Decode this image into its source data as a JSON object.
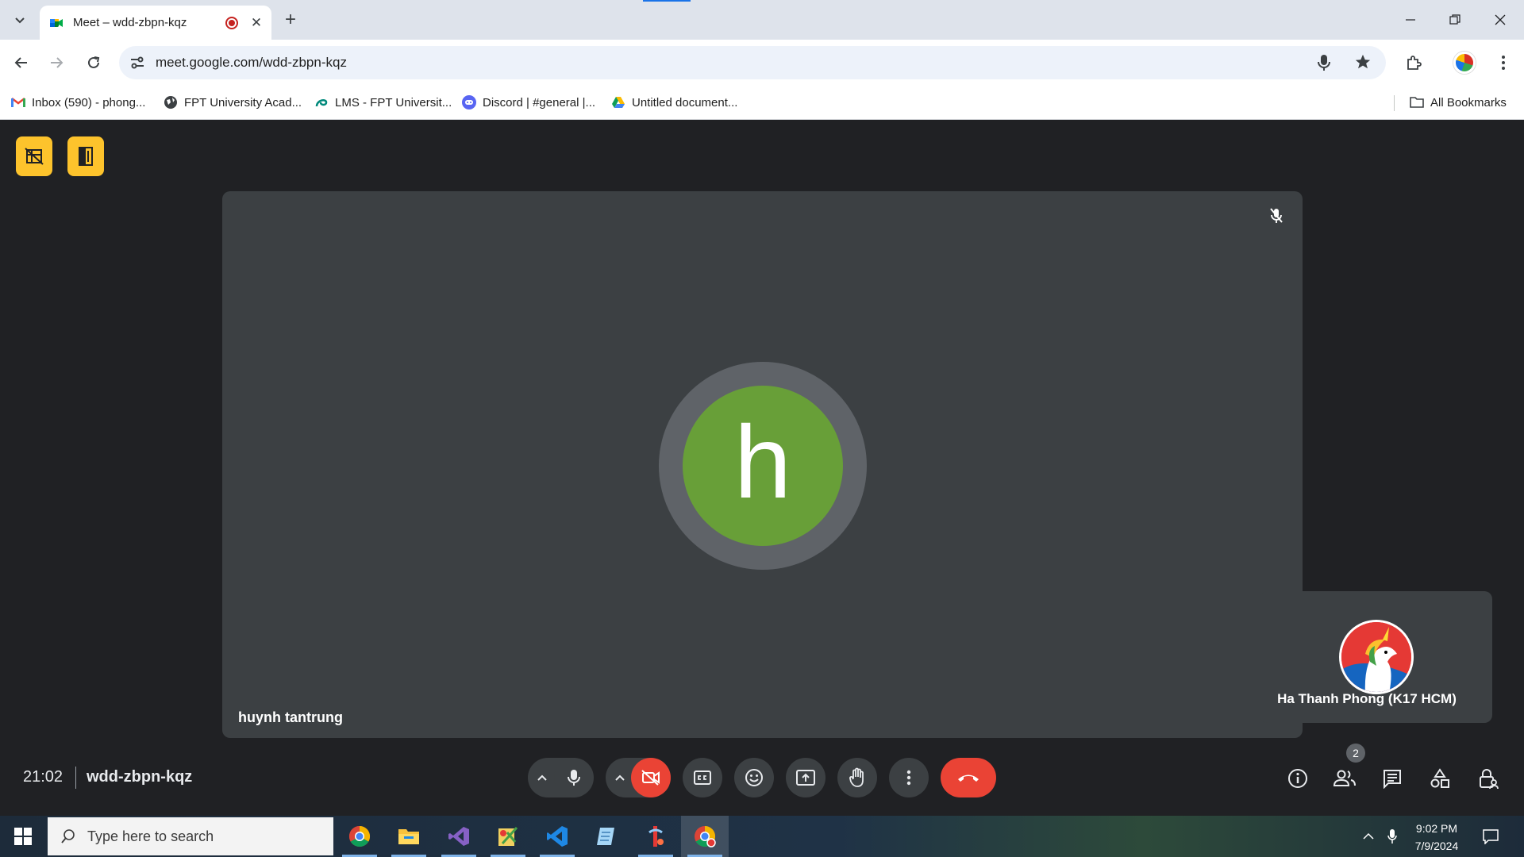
{
  "browser": {
    "tab_title": "Meet – wdd-zbpn-kqz",
    "url": "meet.google.com/wdd-zbpn-kqz",
    "bookmarks": [
      {
        "label": "Inbox (590) - phong...",
        "icon": "gmail-icon"
      },
      {
        "label": "FPT University Acad...",
        "icon": "globe-icon"
      },
      {
        "label": "LMS - FPT Universit...",
        "icon": "lms-icon"
      },
      {
        "label": "Discord | #general |...",
        "icon": "discord-icon"
      },
      {
        "label": "Untitled document...",
        "icon": "drive-icon"
      }
    ],
    "all_bookmarks_label": "All Bookmarks"
  },
  "meet": {
    "main_participant": {
      "name": "huynh tantrung",
      "initial": "h",
      "avatar_color": "#689f38",
      "muted": true
    },
    "self_participant": {
      "name": "Ha Thanh Phong (K17 HCM)"
    },
    "time": "21:02",
    "meeting_code": "wdd-zbpn-kqz",
    "people_count": "2",
    "camera_off": true,
    "accent_colors": {
      "end_call": "#ea4335",
      "toolbar_yellow": "#fdc32c",
      "background": "#202124",
      "tile": "#3c4043"
    }
  },
  "taskbar": {
    "search_placeholder": "Type here to search",
    "clock_time": "9:02 PM",
    "clock_date": "7/9/2024",
    "apps": [
      "chrome-icon",
      "file-explorer-icon",
      "visual-studio-icon",
      "app-icon",
      "vscode-icon",
      "notepad-icon",
      "app-icon-2",
      "chrome-profile-icon"
    ]
  }
}
